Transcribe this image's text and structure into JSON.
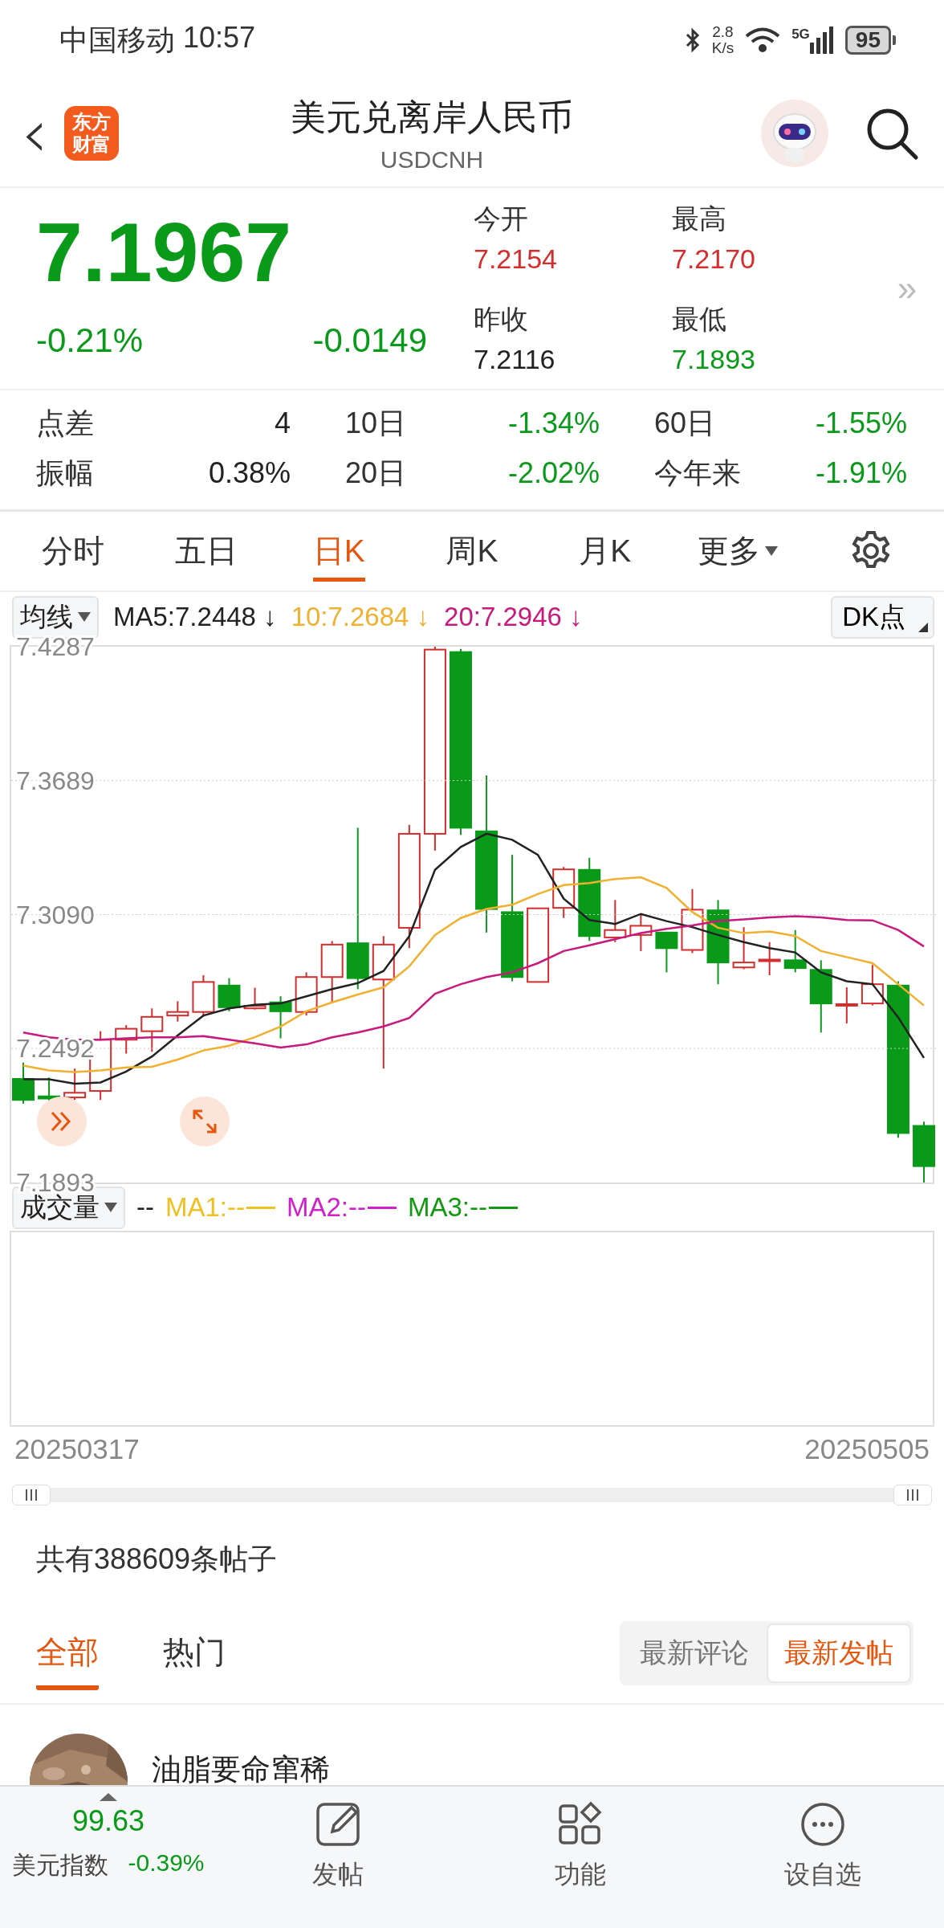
{
  "status_bar": {
    "carrier": "中国移动",
    "time": "10:57",
    "speed": "2.8",
    "speed_unit": "K/s",
    "network": "5G",
    "battery": "95"
  },
  "header": {
    "back": "‹",
    "logo": [
      "东方",
      "财富"
    ],
    "title": "美元兑离岸人民币",
    "subtitle": "USDCNH"
  },
  "quote": {
    "price": "7.1967",
    "change_pct": "-0.21%",
    "change": "-0.0149",
    "color": "#0a9a1a",
    "more": "»",
    "fields": [
      {
        "label": "今开",
        "value": "7.2154",
        "color": "#d42d2d"
      },
      {
        "label": "最高",
        "value": "7.2170",
        "color": "#d42d2d"
      },
      {
        "label": "昨收",
        "value": "7.2116",
        "color": "#222222"
      },
      {
        "label": "最低",
        "value": "7.1893",
        "color": "#0a9a1a"
      }
    ]
  },
  "stats": [
    {
      "label": "点差",
      "value": "4",
      "color": "#222222"
    },
    {
      "label": "10日",
      "value": "-1.34%",
      "color": "#0a9a1a"
    },
    {
      "label": "60日",
      "value": "-1.55%",
      "color": "#0a9a1a"
    },
    {
      "label": "振幅",
      "value": "0.38%",
      "color": "#222222"
    },
    {
      "label": "20日",
      "value": "-2.02%",
      "color": "#0a9a1a"
    },
    {
      "label": "今年来",
      "value": "-1.91%",
      "color": "#0a9a1a"
    }
  ],
  "period_tabs": [
    {
      "label": "分时",
      "selected": false,
      "kind": "tab"
    },
    {
      "label": "五日",
      "selected": false,
      "kind": "tab"
    },
    {
      "label": "日K",
      "selected": true,
      "kind": "tab"
    },
    {
      "label": "周K",
      "selected": false,
      "kind": "tab"
    },
    {
      "label": "月K",
      "selected": false,
      "kind": "tab"
    },
    {
      "label": "更多",
      "selected": false,
      "kind": "menu"
    },
    {
      "selected": false,
      "kind": "settings"
    }
  ],
  "chart": {
    "indicator": "均线",
    "dk_button": "DK点",
    "legend": [
      {
        "label": "MA5:7.2448",
        "arrow": "↓",
        "color": "#222222"
      },
      {
        "label": "10:7.2684",
        "arrow": "↓",
        "color": "#f0b030"
      },
      {
        "label": "20:7.2946",
        "arrow": "↓",
        "color": "#c8197f"
      }
    ],
    "chart_data": {
      "type": "line",
      "ylim": [
        7.1893,
        7.4287
      ],
      "yticks": [
        {
          "value": 7.1893,
          "label": "7.1893"
        },
        {
          "value": 7.2492,
          "label": "7.2492"
        },
        {
          "value": 7.309,
          "label": "7.3090"
        },
        {
          "value": 7.3689,
          "label": "7.3689"
        },
        {
          "value": 7.4287,
          "label": "7.4287"
        }
      ],
      "series": [
        {
          "color": "#222222",
          "values": [
            7.2354,
            7.2354,
            7.2335,
            7.234,
            7.2389,
            7.2456,
            7.255,
            7.2639,
            7.2671,
            7.2687,
            7.2693,
            7.2725,
            7.2757,
            7.2784,
            7.2838,
            7.2994,
            7.329,
            7.3392,
            7.3451,
            7.3424,
            7.3357,
            7.3161,
            7.3066,
            7.3048,
            7.3093,
            7.3061,
            7.3034,
            7.2999,
            7.2967,
            7.294,
            7.2921,
            7.2832,
            7.2792,
            7.2779,
            7.2631,
            7.245
          ]
        },
        {
          "color": "#f0b030",
          "values": [
            7.2415,
            7.2394,
            7.2386,
            7.2394,
            7.2407,
            7.241,
            7.2442,
            7.2483,
            7.2504,
            7.2542,
            7.259,
            7.2658,
            7.2698,
            7.2733,
            7.2765,
            7.2859,
            7.2999,
            7.3075,
            7.3115,
            7.3134,
            7.3182,
            7.3222,
            7.3231,
            7.3249,
            7.3257,
            7.3209,
            7.3101,
            7.3031,
            7.3007,
            7.3015,
            7.2994,
            7.2927,
            7.29,
            7.2873,
            7.2779,
            7.2684
          ]
        },
        {
          "color": "#c8197f",
          "values": [
            7.2563,
            7.2542,
            7.2531,
            7.2531,
            7.2537,
            7.2542,
            7.2542,
            7.2547,
            7.2531,
            7.2515,
            7.2496,
            7.251,
            7.2542,
            7.2563,
            7.259,
            7.2628,
            7.2736,
            7.2779,
            7.2811,
            7.2832,
            7.2873,
            7.2927,
            7.2953,
            7.298,
            7.3007,
            7.3026,
            7.3042,
            7.3061,
            7.3069,
            7.3077,
            7.3083,
            7.3077,
            7.3066,
            7.3064,
            7.3021,
            7.2948
          ]
        }
      ],
      "grid": true
    }
  },
  "volume": {
    "indicator": "成交量",
    "value": "--",
    "legend": [
      {
        "label": "MA1:--",
        "color": "#f0c020"
      },
      {
        "label": "MA2:--",
        "color": "#d020c8"
      },
      {
        "label": "MA3:--",
        "color": "#119911"
      }
    ]
  },
  "date_range": {
    "start": "20250317",
    "end": "20250505"
  },
  "posts": {
    "count": "共有388609条帖子",
    "tabs": [
      {
        "label": "全部",
        "selected": true
      },
      {
        "label": "热门",
        "selected": false
      }
    ],
    "sort": [
      {
        "label": "最新评论",
        "selected": false
      },
      {
        "label": "最新发帖",
        "selected": true
      }
    ],
    "items": [
      {
        "author": "油脂要命窜稀"
      }
    ]
  },
  "bottom_bar": {
    "index": {
      "value": "99.63",
      "name": "美元指数",
      "change": "-0.39%",
      "color": "#0a9a1a"
    },
    "actions": [
      {
        "label": "发帖",
        "kind": "edit"
      },
      {
        "label": "功能",
        "kind": "grid"
      },
      {
        "label": "设自选",
        "kind": "more"
      }
    ]
  }
}
